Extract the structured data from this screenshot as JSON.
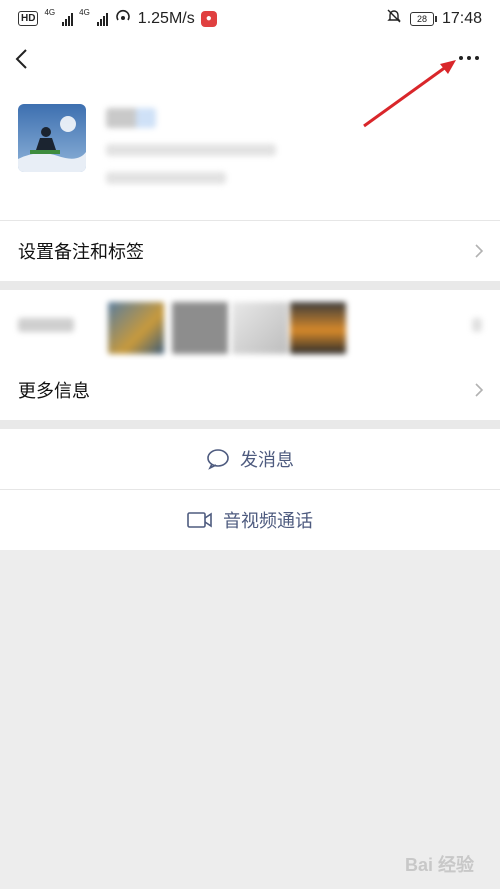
{
  "status_bar": {
    "hd_label": "HD",
    "network_1": "4G",
    "network_2": "4G",
    "speed": "1.25M/s",
    "battery": "28",
    "time": "17:48"
  },
  "menu": {
    "set_remark_label": "设置备注和标签",
    "more_info_label": "更多信息"
  },
  "actions": {
    "send_message": "发消息",
    "video_call": "音视频通话"
  },
  "watermark": "Bai 经验",
  "colors": {
    "action_text": "#4e5b7f",
    "background": "#ededed",
    "arrow": "#d9262a"
  }
}
